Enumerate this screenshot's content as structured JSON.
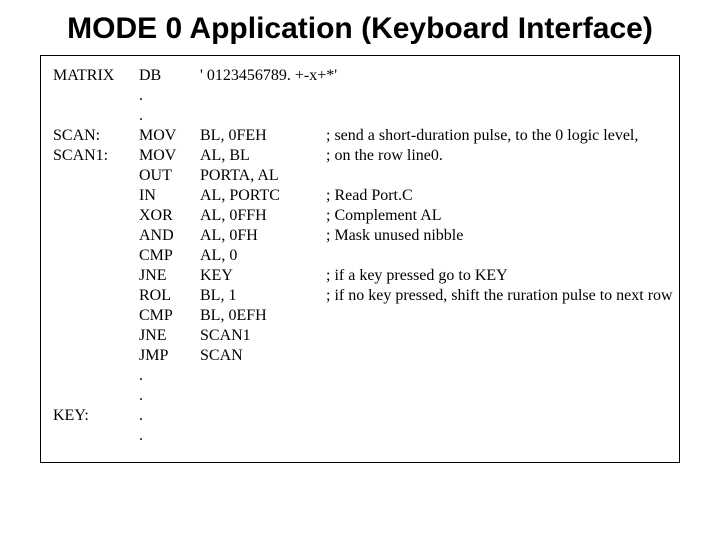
{
  "title": "MODE 0 Application (Keyboard Interface)",
  "lines": [
    {
      "label": "MATRIX",
      "op": "DB",
      "operand": "' 0123456789. +-x+*'",
      "comment": ""
    },
    {
      "label": "",
      "op": ".",
      "operand": "",
      "comment": ""
    },
    {
      "label": "",
      "op": ".",
      "operand": "",
      "comment": ""
    },
    {
      "label": "SCAN:",
      "op": "MOV",
      "operand": "BL, 0FEH",
      "comment": "; send a short-duration pulse, to the 0 logic level,"
    },
    {
      "label": "SCAN1:",
      "op": "MOV",
      "operand": "AL, BL",
      "comment": "; on the row line0."
    },
    {
      "label": "",
      "op": "OUT",
      "operand": "PORTA, AL",
      "comment": ""
    },
    {
      "label": "",
      "op": "IN",
      "operand": "AL, PORTC",
      "comment": "; Read Port.C"
    },
    {
      "label": "",
      "op": "XOR",
      "operand": "AL, 0FFH",
      "comment": "; Complement AL"
    },
    {
      "label": "",
      "op": "AND",
      "operand": "AL, 0FH",
      "comment": "; Mask unused nibble"
    },
    {
      "label": "",
      "op": "CMP",
      "operand": "AL, 0",
      "comment": ""
    },
    {
      "label": "",
      "op": "JNE",
      "operand": "KEY",
      "comment": "; if a key pressed go to KEY"
    },
    {
      "label": "",
      "op": "ROL",
      "operand": "BL, 1",
      "comment": "; if no key pressed, shift the ruration pulse to next row"
    },
    {
      "label": "",
      "op": "CMP",
      "operand": "BL, 0EFH",
      "comment": ""
    },
    {
      "label": "",
      "op": "JNE",
      "operand": "SCAN1",
      "comment": ""
    },
    {
      "label": "",
      "op": "JMP",
      "operand": "SCAN",
      "comment": ""
    },
    {
      "label": "",
      "op": ".",
      "operand": "",
      "comment": ""
    },
    {
      "label": "",
      "op": ".",
      "operand": "",
      "comment": ""
    },
    {
      "label": "KEY:",
      "op": ".",
      "operand": "",
      "comment": ""
    },
    {
      "label": "",
      "op": ".",
      "operand": "",
      "comment": ""
    }
  ]
}
